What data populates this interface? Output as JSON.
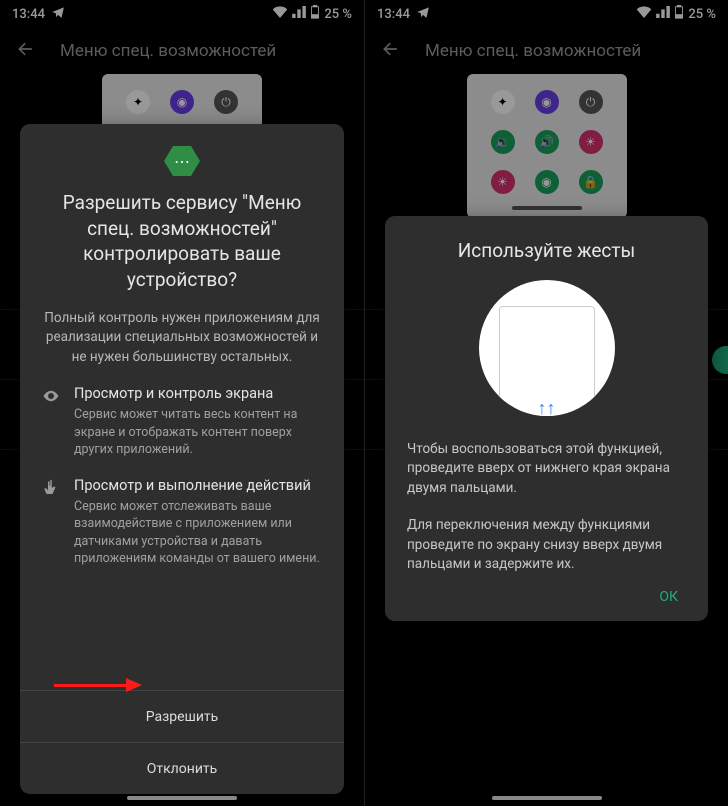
{
  "status": {
    "time": "13:44",
    "battery": "25 %"
  },
  "screen": {
    "title": "Меню спец. возможностей"
  },
  "preview_icons": {
    "assistant": "●",
    "a11y": "◉",
    "power": "⏻",
    "vol_down": "🔉",
    "vol_up": "🔊",
    "bright": "☀",
    "bright2": "☀",
    "a11y2": "◉",
    "lock": "🔒"
  },
  "dialog1": {
    "title": "Разрешить сервису \"Меню спец. возможностей\" контролировать ваше устройство?",
    "body": "Полный контроль нужен приложениям для реализации специальных возможностей и не нужен большинству остальных.",
    "perm_view_title": "Просмотр и контроль экрана",
    "perm_view_desc": "Сервис может читать весь контент на экране и отображать контент поверх других приложений.",
    "perm_action_title": "Просмотр и выполнение действий",
    "perm_action_desc": "Сервис может отслеживать ваше взаимодействие с приложением или датчиками устройства и давать приложениям команды от вашего имени.",
    "allow": "Разрешить",
    "deny": "Отклонить"
  },
  "dialog2": {
    "title": "Используйте жесты",
    "body1": "Чтобы воспользоваться этой функцией, проведите вверх от нижнего края экрана двумя пальцами.",
    "body2": "Для переключения между функциями проведите по экрану снизу вверх двумя пальцами и задержите их.",
    "ok": "ОК"
  }
}
